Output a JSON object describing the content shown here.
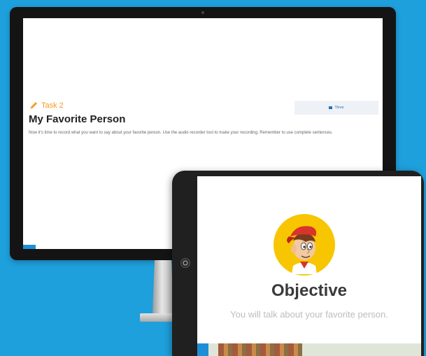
{
  "monitor": {
    "task": {
      "label": "Task 2",
      "icon": "pencil-icon",
      "title": "My Favorite Person",
      "description": "Now it's time to record what you want to say about your favorite person. Use the audio recorder tool to make your recording. Remember to use complete sentences."
    },
    "right_button_label": "Three"
  },
  "tablet": {
    "objective_title": "Objective",
    "objective_text": "You will talk about your favorite person."
  },
  "colors": {
    "background": "#1ea0dc",
    "task_accent": "#f39a1f",
    "avatar_circle": "#f7c600",
    "cap_red": "#d9342b"
  }
}
